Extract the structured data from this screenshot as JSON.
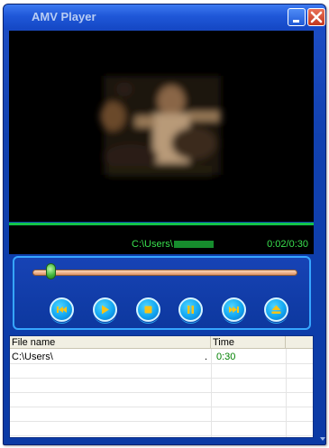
{
  "window": {
    "title": "AMV Player",
    "minimize_icon": "minimize-icon",
    "close_icon": "close-icon"
  },
  "status": {
    "path": "C:\\Users\\",
    "time": "0:02/0:30"
  },
  "seek": {
    "position_fraction": 0.07
  },
  "controls": [
    {
      "name": "previous",
      "icon": "skip-previous-icon"
    },
    {
      "name": "play",
      "icon": "play-icon"
    },
    {
      "name": "stop",
      "icon": "stop-icon"
    },
    {
      "name": "pause",
      "icon": "pause-icon"
    },
    {
      "name": "next",
      "icon": "skip-next-icon"
    },
    {
      "name": "eject",
      "icon": "eject-icon"
    }
  ],
  "playlist": {
    "columns": [
      "File name",
      "Time"
    ],
    "rows": [
      {
        "file": "C:\\Users\\",
        "dot": ".",
        "time": "0:30"
      }
    ]
  },
  "colors": {
    "accent_green": "#39e04e",
    "window_blue": "#0b3aa5",
    "button_blue": "#12a7f2"
  }
}
